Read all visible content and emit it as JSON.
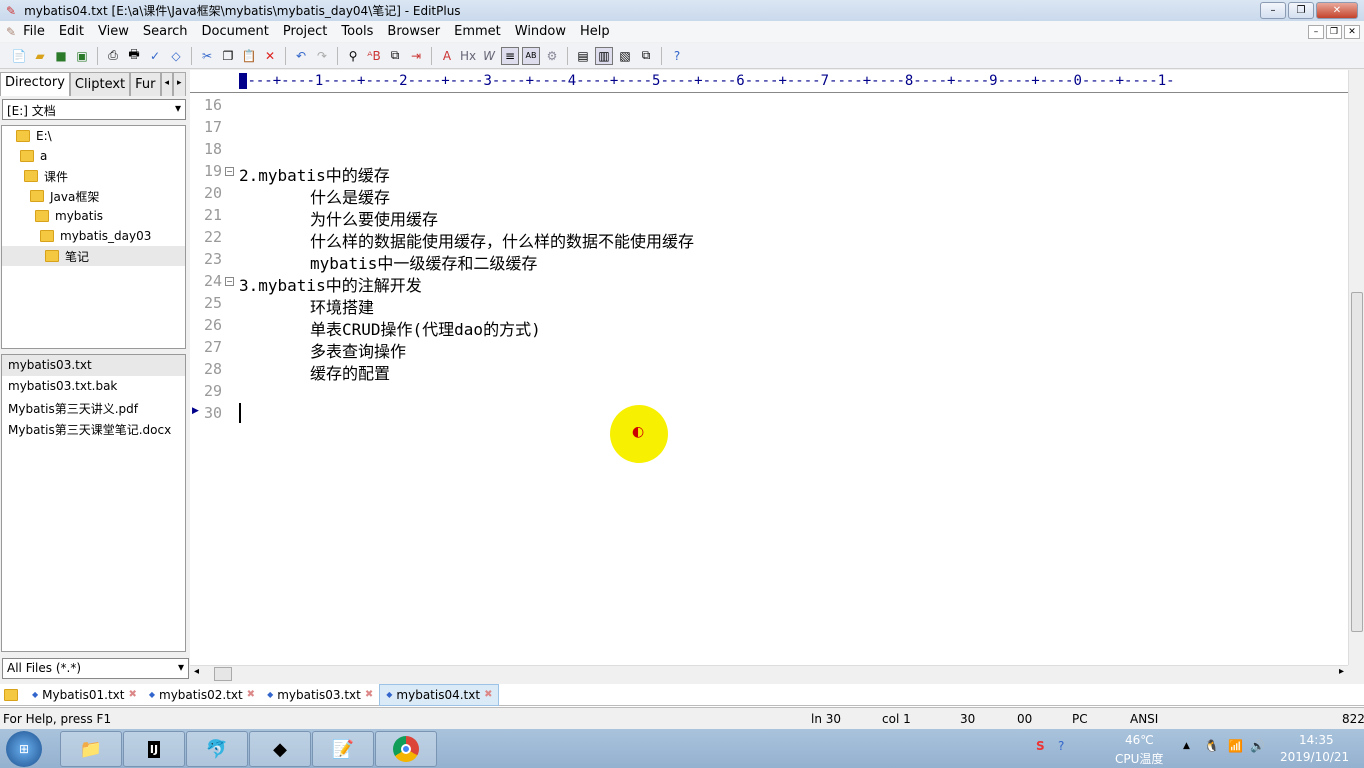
{
  "window": {
    "title": "mybatis04.txt [E:\\a\\课件\\Java框架\\mybatis\\mybatis_day04\\笔记] - EditPlus"
  },
  "menu": [
    "File",
    "Edit",
    "View",
    "Search",
    "Document",
    "Project",
    "Tools",
    "Browser",
    "Emmet",
    "Window",
    "Help"
  ],
  "left_panel": {
    "tabs": [
      "Directory",
      "Cliptext",
      "Fur"
    ],
    "drive": "[E:] 文档",
    "tree": [
      "E:\\",
      "a",
      "课件",
      "Java框架",
      "mybatis",
      "mybatis_day03",
      "笔记"
    ],
    "files": [
      "mybatis03.txt",
      "mybatis03.txt.bak",
      "Mybatis第三天讲义.pdf",
      "Mybatis第三天课堂笔记.docx"
    ],
    "filter": "All Files (*.*)"
  },
  "ruler": "---+----1----+----2----+----3----+----4----+----5----+----6----+----7----+----8----+----9----+----0----+----1-",
  "editor": {
    "lines": [
      {
        "n": "16",
        "t": ""
      },
      {
        "n": "17",
        "t": ""
      },
      {
        "n": "18",
        "t": ""
      },
      {
        "n": "19",
        "t": "2.mybatis中的缓存",
        "fold": true
      },
      {
        "n": "20",
        "t": "\t什么是缓存"
      },
      {
        "n": "21",
        "t": "\t为什么要使用缓存"
      },
      {
        "n": "22",
        "t": "\t什么样的数据能使用缓存，什么样的数据不能使用缓存"
      },
      {
        "n": "23",
        "t": "\tmybatis中一级缓存和二级缓存"
      },
      {
        "n": "24",
        "t": "3.mybatis中的注解开发",
        "fold": true
      },
      {
        "n": "25",
        "t": "\t环境搭建"
      },
      {
        "n": "26",
        "t": "\t单表CRUD操作(代理dao的方式)"
      },
      {
        "n": "27",
        "t": "\t多表查询操作"
      },
      {
        "n": "28",
        "t": "\t缓存的配置"
      },
      {
        "n": "29",
        "t": ""
      },
      {
        "n": "30",
        "t": ""
      }
    ]
  },
  "doc_tabs": [
    "Mybatis01.txt",
    "mybatis02.txt",
    "mybatis03.txt",
    "mybatis04.txt"
  ],
  "active_tab": "mybatis04.txt",
  "status": {
    "help": "For Help, press F1",
    "ln": "ln 30",
    "col": "col 1",
    "n": "30",
    "code": "00",
    "mode": "PC",
    "enc": "ANSI",
    "size": "822"
  },
  "taskbar": {
    "temp": "46℃",
    "temp_label": "CPU温度",
    "time": "14:35",
    "date": "2019/10/21"
  },
  "colors": {
    "ruler": "#00008b",
    "highlight": "#f7f000"
  }
}
